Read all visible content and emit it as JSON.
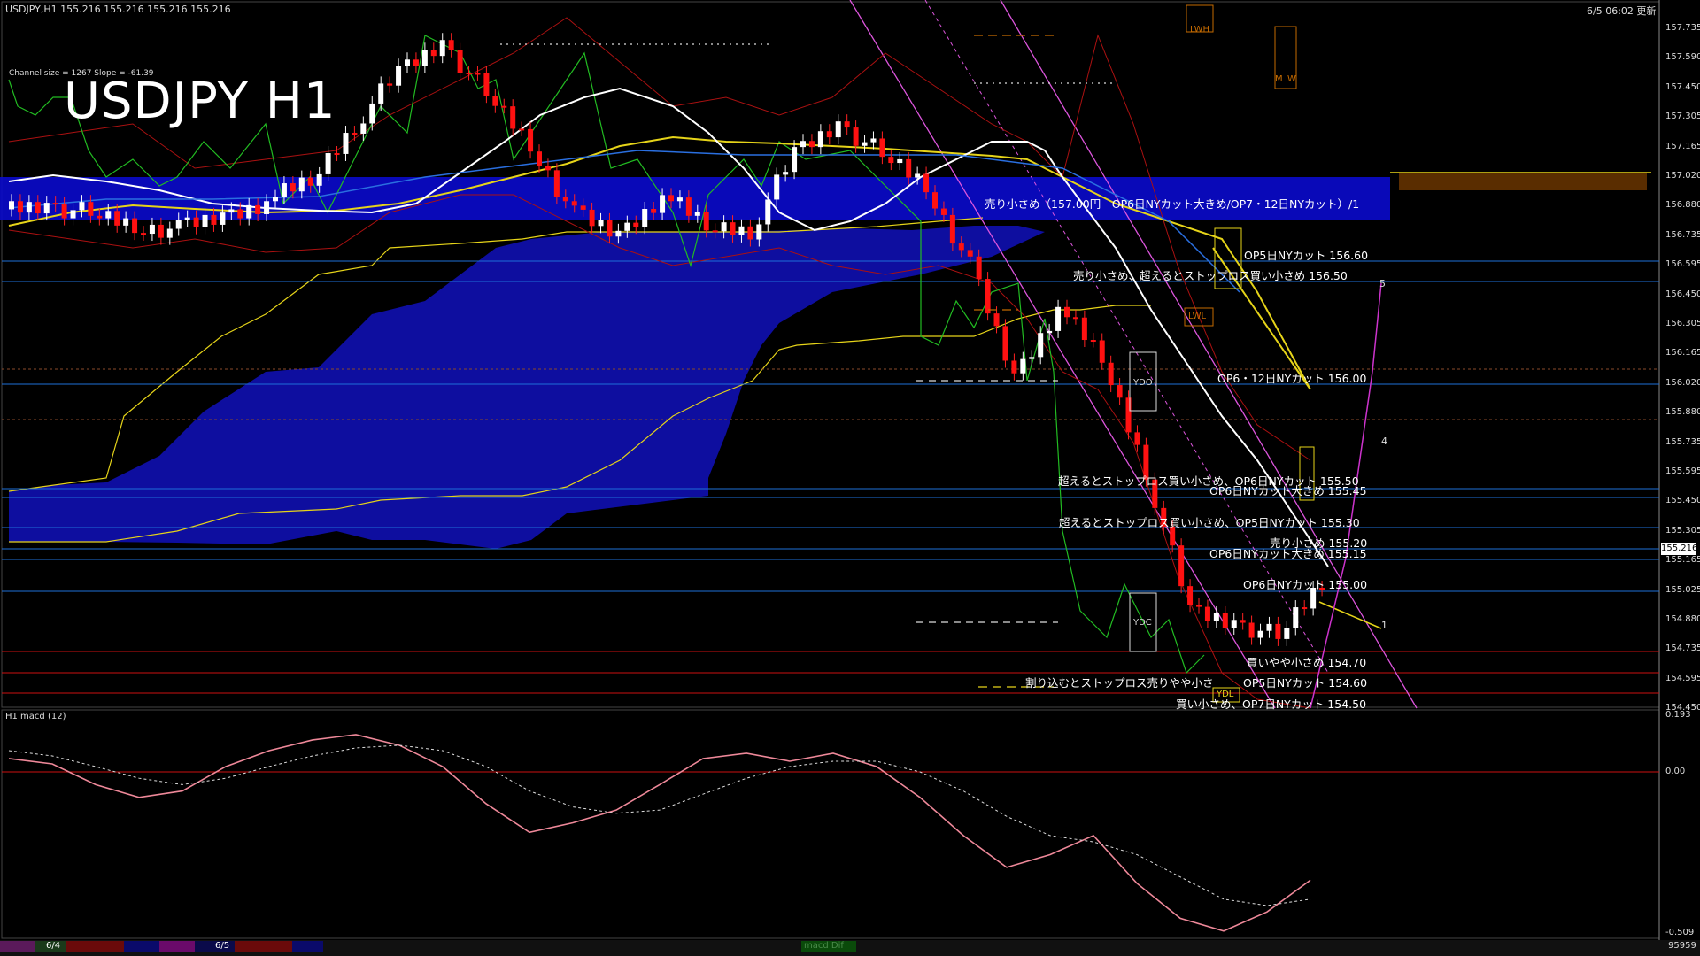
{
  "header": {
    "symbol_info": "USDJPY,H1  155.216 155.216 155.216 155.216",
    "datetime": "6/5 06:02 更新",
    "channel_info": "Channel size = 1267 Slope = -61.39",
    "big_title": "USDJPY H1",
    "subwindow_label": "H1  macd (12)"
  },
  "price_labels": [
    "157.735",
    "157.590",
    "157.450",
    "157.305",
    "157.165",
    "157.020",
    "156.880",
    "156.735",
    "156.595",
    "156.450",
    "156.305",
    "156.165",
    "156.020",
    "155.880",
    "155.735",
    "155.595",
    "155.450",
    "155.305",
    "155.165",
    "155.025",
    "154.880",
    "154.735",
    "154.595",
    "154.450"
  ],
  "current_price": "155.216",
  "macd_labels": [
    "0.193",
    "0.00",
    "-0.509"
  ],
  "footer": {
    "bottom_right": "95959",
    "tab_date_1": "6/4",
    "tab_date_2": "6/5",
    "macd_tab": "macd Dif"
  },
  "annotations": [
    "売り小さめ（157.00円　OP6日NYカット大きめ/OP7・12日NYカット）/1",
    "OP5日NYカット 156.60",
    "売り小さめ、超えるとストップロス買い小さめ 156.50",
    "OP6・12日NYカット 156.00",
    "超えるとストップロス買い小さめ、OP6日NYカット 155.50",
    "OP6日NYカット大きめ 155.45",
    "超えるとストップロス買い小さめ、OP5日NYカット 155.30",
    "売り小さめ 155.20",
    "OP6日NYカット大きめ 155.15",
    "OP6日NYカット 155.00",
    "買いやや小さめ 154.70",
    "割り込むとストップロス売りやや小さ",
    "OP5日NYカット 154.60",
    "買い小さめ、OP7日NYカット 154.50"
  ],
  "box_labels": [
    "LWH",
    "LWL",
    "YDO",
    "YDC",
    "YDL",
    "M",
    "W"
  ],
  "wave_labels": [
    "5",
    "4",
    "1"
  ],
  "chart_data": {
    "type": "line",
    "title": "USDJPY H1",
    "ylim": [
      154.45,
      157.8
    ],
    "x": [
      0,
      5,
      10,
      15,
      20,
      25,
      30,
      35,
      40,
      45,
      50,
      55,
      60,
      65,
      70,
      75,
      80,
      85,
      90,
      95,
      100,
      105,
      110,
      115,
      120,
      125,
      130,
      135,
      140,
      145,
      150
    ],
    "series": [
      {
        "name": "USDJPY",
        "values": [
          156.88,
          156.9,
          156.86,
          156.8,
          156.78,
          156.84,
          156.92,
          157.02,
          157.3,
          157.55,
          157.7,
          157.45,
          157.2,
          156.85,
          156.75,
          156.95,
          156.8,
          156.78,
          157.15,
          157.3,
          157.15,
          157.0,
          156.6,
          156.05,
          156.4,
          156.15,
          155.6,
          154.9,
          154.85,
          154.78,
          155.05
        ]
      },
      {
        "name": "",
        "values": [
          156.85,
          156.86,
          156.86,
          156.84,
          156.82,
          156.8,
          156.85,
          156.95,
          157.1,
          157.25,
          157.35,
          157.4,
          157.35,
          157.2,
          157.05,
          156.95,
          156.9,
          156.88,
          156.95,
          157.05,
          157.1,
          157.05,
          156.9,
          156.6,
          156.35,
          156.2,
          155.95,
          155.5,
          155.2,
          154.95,
          154.9
        ]
      }
    ],
    "macd": {
      "ylim": [
        -0.509,
        0.193
      ],
      "values": [
        0.05,
        0.03,
        -0.04,
        -0.08,
        -0.06,
        0.02,
        0.08,
        0.12,
        0.14,
        0.1,
        0.02,
        -0.1,
        -0.19,
        -0.16,
        -0.12,
        -0.04,
        0.05,
        0.07,
        0.04,
        0.07,
        0.02,
        -0.08,
        -0.2,
        -0.3,
        -0.26,
        -0.2,
        -0.35,
        -0.46,
        -0.5,
        -0.44,
        -0.34
      ],
      "signal": [
        0.08,
        0.06,
        0.02,
        -0.02,
        -0.04,
        -0.02,
        0.02,
        0.06,
        0.09,
        0.1,
        0.08,
        0.02,
        -0.06,
        -0.11,
        -0.13,
        -0.12,
        -0.07,
        -0.02,
        0.02,
        0.04,
        0.04,
        0.0,
        -0.06,
        -0.14,
        -0.2,
        -0.22,
        -0.26,
        -0.33,
        -0.4,
        -0.42,
        -0.4
      ]
    }
  },
  "colors": {
    "background": "#000000",
    "cloud": "#1a1acc",
    "up_candle": "#ffffff",
    "down_candle": "#ff1111",
    "ma_white": "#ffffff",
    "ma_yellow": "#e6d419",
    "chikou": "#22bb22",
    "bollinger": "#cc1111",
    "channel": "#dd55dd",
    "macd_up": "#22dd22",
    "macd_down": "#ee8899"
  }
}
